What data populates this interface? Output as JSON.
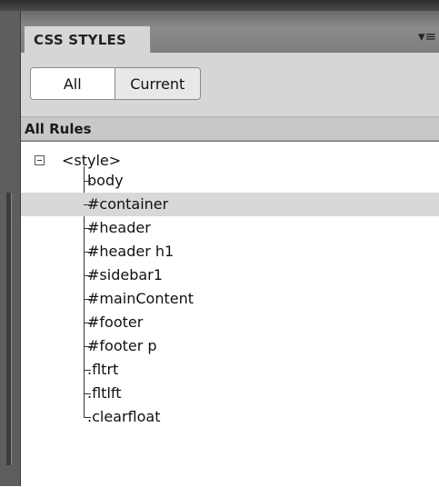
{
  "panel": {
    "tab_label": "CSS STYLES",
    "menu_icon": "panel-options-icon"
  },
  "toolbar": {
    "all_label": "All",
    "current_label": "Current",
    "active": "All"
  },
  "rules": {
    "header": "All Rules",
    "root": "<style>",
    "items": [
      {
        "label": "body",
        "selected": false
      },
      {
        "label": "#container",
        "selected": true
      },
      {
        "label": "#header",
        "selected": false
      },
      {
        "label": "#header h1",
        "selected": false
      },
      {
        "label": "#sidebar1",
        "selected": false
      },
      {
        "label": "#mainContent",
        "selected": false
      },
      {
        "label": "#footer",
        "selected": false
      },
      {
        "label": "#footer p",
        "selected": false
      },
      {
        "label": ".fltrt",
        "selected": false
      },
      {
        "label": ".fltlft",
        "selected": false
      },
      {
        "label": ".clearfloat",
        "selected": false
      }
    ]
  }
}
